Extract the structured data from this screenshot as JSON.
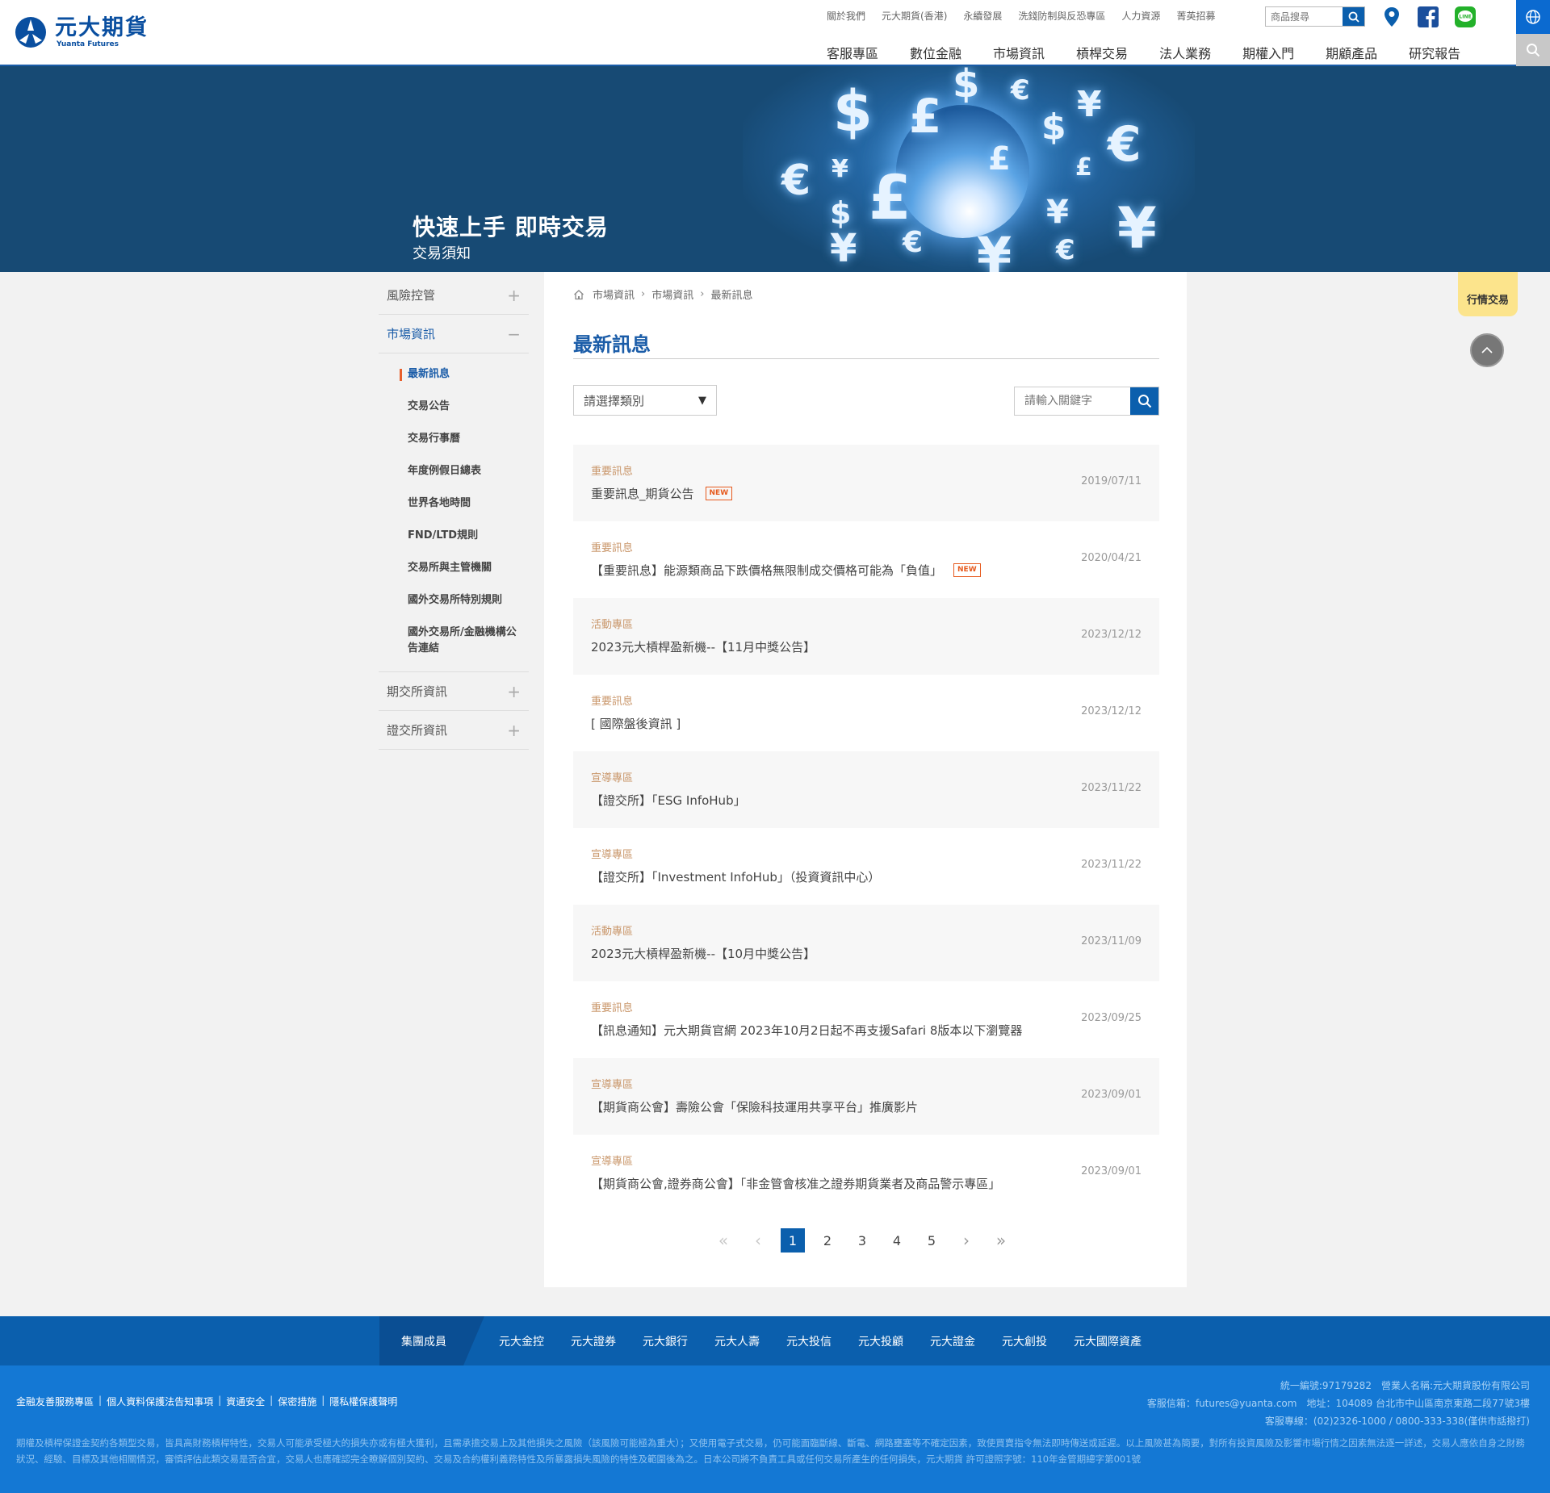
{
  "brand": {
    "name_cn": "元大期貨",
    "name_en": "Yuanta Futures"
  },
  "top_links": [
    "關於我們",
    "元大期貨(香港)",
    "永續發展",
    "洗錢防制與反恐專區",
    "人力資源",
    "菁英招募"
  ],
  "top_search": {
    "placeholder": "商品搜尋"
  },
  "main_nav": [
    "客服專區",
    "數位金融",
    "市場資訊",
    "槓桿交易",
    "法人業務",
    "期權入門",
    "期顧產品",
    "研究報告"
  ],
  "banner": {
    "title": "快速上手 即時交易",
    "subtitle": "交易須知"
  },
  "sidebar": {
    "items": [
      {
        "label": "風險控管",
        "sign": "+"
      },
      {
        "label": "市場資訊",
        "sign": "−"
      },
      {
        "label": "期交所資訊",
        "sign": "+"
      },
      {
        "label": "證交所資訊",
        "sign": "+"
      }
    ],
    "sub_items": [
      "最新訊息",
      "交易公告",
      "交易行事曆",
      "年度例假日總表",
      "世界各地時間",
      "FND/LTD規則",
      "交易所與主管機關",
      "國外交易所特別規則",
      "國外交易所/金融機構公告連結"
    ]
  },
  "breadcrumb": [
    "市場資訊",
    "市場資訊",
    "最新訊息"
  ],
  "page_title": "最新訊息",
  "filter": {
    "select_label": "請選擇類別",
    "arrow": "▼",
    "keyword_placeholder": "請輸入關鍵字"
  },
  "new_badge": "NEW",
  "news": [
    {
      "category": "重要訊息",
      "title": "重要訊息_期貨公告",
      "date": "2019/07/11",
      "is_new": true
    },
    {
      "category": "重要訊息",
      "title": "【重要訊息】能源類商品下跌價格無限制成交價格可能為「負值」",
      "date": "2020/04/21",
      "is_new": true
    },
    {
      "category": "活動專區",
      "title": "2023元大槓桿盈新機--【11月中獎公告】",
      "date": "2023/12/12",
      "is_new": false
    },
    {
      "category": "重要訊息",
      "title": "[ 國際盤後資訊 ]",
      "date": "2023/12/12",
      "is_new": false
    },
    {
      "category": "宣導專區",
      "title": "【證交所】「ESG InfoHub」",
      "date": "2023/11/22",
      "is_new": false
    },
    {
      "category": "宣導專區",
      "title": "【證交所】「Investment InfoHub」（投資資訊中心）",
      "date": "2023/11/22",
      "is_new": false
    },
    {
      "category": "活動專區",
      "title": "2023元大槓桿盈新機--【10月中獎公告】",
      "date": "2023/11/09",
      "is_new": false
    },
    {
      "category": "重要訊息",
      "title": "【訊息通知】元大期貨官網 2023年10月2日起不再支援Safari 8版本以下瀏覽器",
      "date": "2023/09/25",
      "is_new": false
    },
    {
      "category": "宣導專區",
      "title": "【期貨商公會】壽險公會「保險科技運用共享平台」推廣影片",
      "date": "2023/09/01",
      "is_new": false
    },
    {
      "category": "宣導專區",
      "title": "【期貨商公會,證券商公會】「非金管會核准之證券期貨業者及商品警示專區」",
      "date": "2023/09/01",
      "is_new": false
    }
  ],
  "pagination": {
    "first": "«",
    "prev": "‹",
    "pages": [
      "1",
      "2",
      "3",
      "4",
      "5"
    ],
    "current": "1",
    "next": "›",
    "last": "»"
  },
  "quote_button": "行情交易",
  "footer": {
    "group_label": "集團成員",
    "group_links": [
      "元大金控",
      "元大證券",
      "元大銀行",
      "元大人壽",
      "元大投信",
      "元大投顧",
      "元大證金",
      "元大創投",
      "元大國際資產"
    ],
    "links": [
      "金融友善服務專區",
      "個人資料保護法告知事項",
      "資通安全",
      "保密措施",
      "隱私權保護聲明"
    ],
    "info_line1": "統一編號:97179282　營業人名稱:元大期貨股份有限公司",
    "info_line2": "客服信箱：futures@yuanta.com　地址：104089 台北市中山區南京東路二段77號3樓",
    "info_line3": "客服專線：(02)2326-1000 / 0800-333-338(僅供市話撥打)",
    "disclaimer": "期權及槓桿保證金契約各類型交易，皆具高財務槓桿特性，交易人可能承受極大的損失亦或有極大獲利，且需承擔交易上及其他損失之風險（該風險可能極為重大）；又使用電子式交易，仍可能面臨斷線、斷電、網路壅塞等不確定因素，致使買賣指令無法即時傳送或延遲。以上風險甚為簡要，對所有投資風險及影響市場行情之因素無法逐一詳述，交易人應依自身之財務狀況、經驗、目標及其他相關情況，審慎評估此類交易是否合宜，交易人也應確認完全瞭解個別契約、交易及合約權利義務特性及所暴露損失風險的特性及範圍後為之。日本公司將不負責工具或任何交易所產生的任何損失，元大期貨 許可證照字號：110年金管期總字第001號"
  },
  "colors": {
    "brand_blue": "#0b5fad",
    "banner_bg": "#174a74",
    "accent_orange": "#e65a1e",
    "category_tan": "#c9966a",
    "quote_yellow": "#fce48c"
  }
}
